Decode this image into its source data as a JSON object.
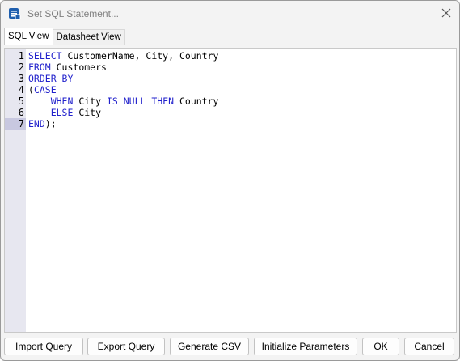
{
  "window": {
    "title": "Set SQL Statement..."
  },
  "tabs": [
    {
      "label": "SQL View",
      "active": true
    },
    {
      "label": "Datasheet View",
      "active": false
    }
  ],
  "editor": {
    "current_line": 7,
    "line_numbers": [
      "1",
      "2",
      "3",
      "4",
      "5",
      "6",
      "7"
    ],
    "lines": [
      [
        {
          "t": "SELECT",
          "k": true
        },
        {
          "t": " CustomerName, City, Country",
          "k": false
        }
      ],
      [
        {
          "t": "FROM",
          "k": true
        },
        {
          "t": " Customers",
          "k": false
        }
      ],
      [
        {
          "t": "ORDER BY",
          "k": true
        }
      ],
      [
        {
          "t": "(",
          "k": false
        },
        {
          "t": "CASE",
          "k": true
        }
      ],
      [
        {
          "t": "    ",
          "k": false
        },
        {
          "t": "WHEN",
          "k": true
        },
        {
          "t": " City ",
          "k": false
        },
        {
          "t": "IS NULL THEN",
          "k": true
        },
        {
          "t": " Country",
          "k": false
        }
      ],
      [
        {
          "t": "    ",
          "k": false
        },
        {
          "t": "ELSE",
          "k": true
        },
        {
          "t": " City",
          "k": false
        }
      ],
      [
        {
          "t": "END",
          "k": true
        },
        {
          "t": ");",
          "k": false
        }
      ]
    ]
  },
  "buttons": {
    "import_query": "Import Query",
    "export_query": "Export Query",
    "generate_csv": "Generate CSV",
    "initialize_parameters": "Initialize Parameters",
    "ok": "OK",
    "cancel": "Cancel"
  },
  "icons": {
    "app": "database-icon",
    "close": "close-icon"
  },
  "colors": {
    "keyword": "#2222cc",
    "gutter": "#e7e7f0",
    "current_line": "#c8c8e0"
  }
}
